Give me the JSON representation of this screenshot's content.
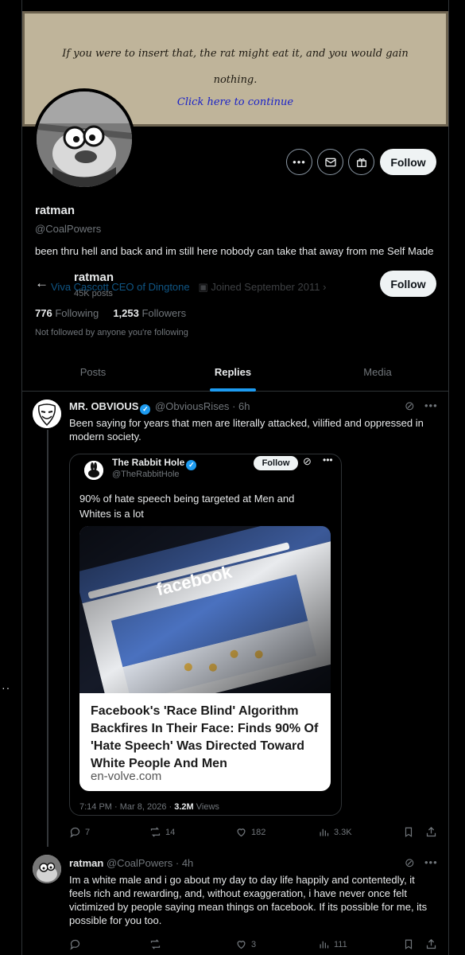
{
  "banner": {
    "line1": "If you were to insert that, the rat might eat it, and you would gain",
    "line2": "nothing.",
    "link": "Click here to continue"
  },
  "profile": {
    "name": "ratman",
    "handle": "@CoalPowers",
    "bio": "been thru hell and back and im still here nobody can take that away from me Self Made",
    "location": "Viva Cascott CEO of Dingtone",
    "joined": "Joined September 2011",
    "following_count": "776",
    "following_label": "Following",
    "followers_count": "1,253",
    "followers_label": "Followers",
    "not_followed": "Not followed by anyone you're following",
    "follow_label": "Follow"
  },
  "sticky_header": {
    "name": "ratman",
    "posts": "45K posts",
    "follow_label": "Follow"
  },
  "tabs": [
    {
      "label": "Posts"
    },
    {
      "label": "Replies"
    },
    {
      "label": "Media"
    }
  ],
  "tweet1": {
    "name": "MR. OBVIOUS",
    "handle": "@ObviousRises",
    "time": "· 6h",
    "text": "Been saying for years that men are literally attacked, vilified and oppressed in modern society.",
    "quote": {
      "name": "The Rabbit Hole",
      "handle": "@TheRabbitHole",
      "follow_label": "Follow",
      "text": "90% of hate speech being targeted at Men and Whites is a lot",
      "card_headline": "Facebook's 'Race Blind' Algorithm Backfires In Their Face: Finds 90% Of 'Hate Speech' Was Directed Toward White People And Men",
      "card_domain": "en-volve.com",
      "image_text": "facebook",
      "date": "7:14 PM · Mar 8, 2026 ·",
      "views_count": "3.2M",
      "views_label": "Views"
    },
    "replies": "7",
    "reposts": "14",
    "likes": "182",
    "views": "3.3K"
  },
  "tweet2": {
    "name": "ratman",
    "handle": "@CoalPowers",
    "time": "· 4h",
    "text": "Im a white male and i go about my day to day life happily and contentedly, it feels rich and rewarding, and, without exaggeration, i have never once felt victimized by people saying mean things on facebook. If its possible for me, its possible for you too.",
    "replies": "",
    "reposts": "",
    "likes": "3",
    "views": "111"
  },
  "colors": {
    "accent": "#1d9bf0",
    "background": "#000000",
    "text": "#e7e9ea",
    "muted": "#71767b",
    "banner": "#bfb49a"
  }
}
